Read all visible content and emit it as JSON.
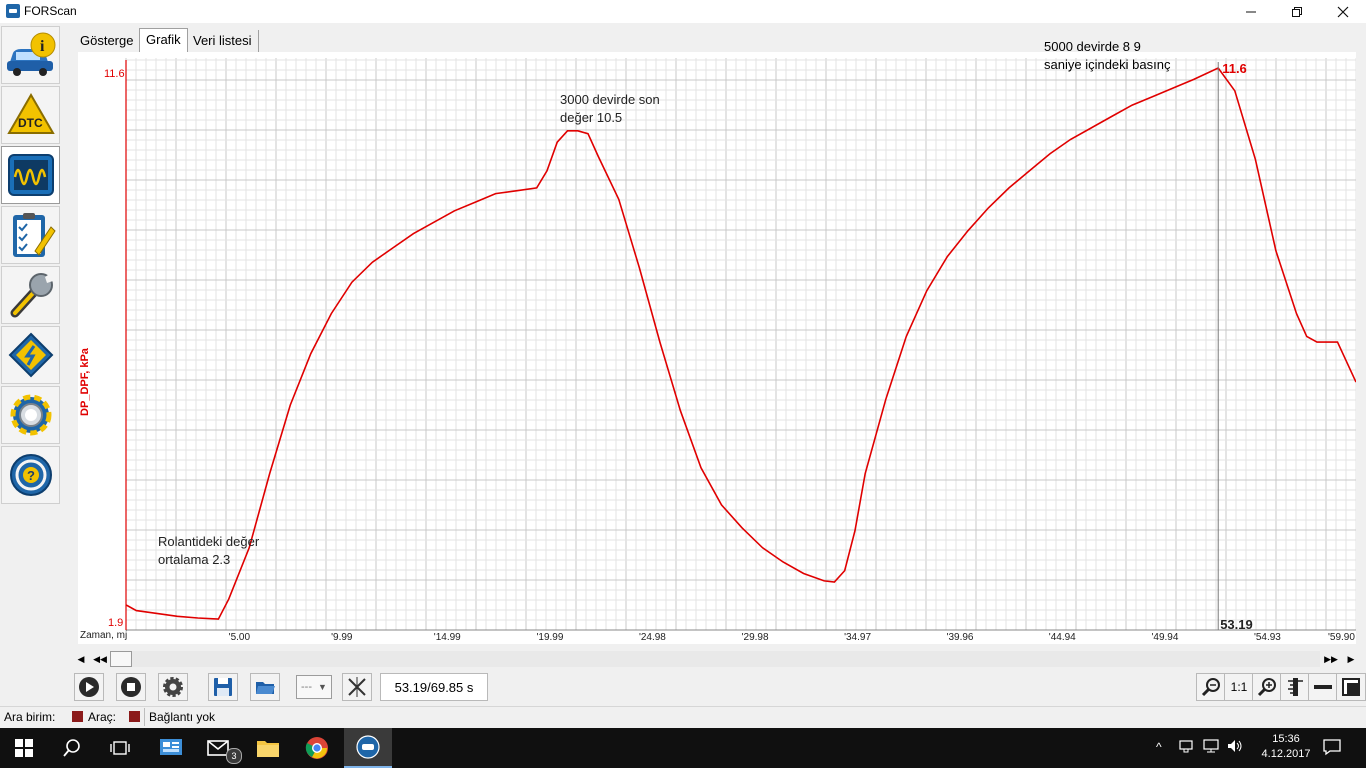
{
  "window": {
    "title": "FORScan"
  },
  "tabs": [
    {
      "label": "Gösterge"
    },
    {
      "label": "Grafik"
    },
    {
      "label": "Veri listesi"
    }
  ],
  "sidebar": {
    "items": [
      {
        "name": "vehicle-info",
        "icon": "car-info-icon"
      },
      {
        "name": "dtc",
        "icon": "dtc-warning-icon"
      },
      {
        "name": "oscilloscope",
        "icon": "oscilloscope-icon"
      },
      {
        "name": "tests",
        "icon": "checklist-icon"
      },
      {
        "name": "service",
        "icon": "wrench-icon"
      },
      {
        "name": "configuration",
        "icon": "chip-icon"
      },
      {
        "name": "settings",
        "icon": "gear-icon"
      },
      {
        "name": "help",
        "icon": "help-steering-icon"
      }
    ]
  },
  "chart_data": {
    "type": "line",
    "ylabel": "DP_DPF, kPa",
    "xlabel": "Zaman, mj",
    "ylim": [
      1.9,
      11.6
    ],
    "xlim": [
      0,
      59.9
    ],
    "y_min_label": "1.9",
    "y_max_label": "11.6",
    "x_tick_labels": [
      "5.00",
      "9.99",
      "14.99",
      "19.99",
      "24.98",
      "29.98",
      "34.97",
      "39.96",
      "44.94",
      "49.94",
      "54.93",
      "59.90"
    ],
    "x_ticks": [
      5.0,
      9.99,
      14.99,
      19.99,
      24.98,
      29.98,
      34.97,
      39.96,
      44.94,
      49.94,
      54.93,
      59.9
    ],
    "series_color": "#e00000",
    "grid": true,
    "series": [
      {
        "x": [
          0,
          0.5,
          1.5,
          2.5,
          3.5,
          4.5,
          5,
          6,
          7,
          8,
          9,
          10,
          11,
          12,
          13,
          14,
          15,
          16,
          17,
          18,
          19,
          20,
          20.5,
          21,
          21.5,
          22,
          22.5,
          23,
          24,
          25,
          26,
          27,
          28,
          29,
          30,
          31,
          32,
          33,
          34,
          34.5,
          35,
          35.5,
          36,
          37,
          38,
          39,
          40,
          41,
          42,
          43,
          44,
          45,
          46,
          47,
          48,
          49,
          50,
          51,
          52,
          53.19,
          54,
          55,
          56,
          57,
          57.5,
          58,
          58.5,
          59,
          59.9
        ],
        "y": [
          2.2,
          2.1,
          2.05,
          2.0,
          1.97,
          1.95,
          2.3,
          3.2,
          4.5,
          5.7,
          6.6,
          7.3,
          7.85,
          8.2,
          8.45,
          8.7,
          8.9,
          9.1,
          9.25,
          9.4,
          9.45,
          9.5,
          9.8,
          10.3,
          10.5,
          10.5,
          10.45,
          10.05,
          9.3,
          8.1,
          6.8,
          5.6,
          4.6,
          3.95,
          3.55,
          3.2,
          2.95,
          2.75,
          2.62,
          2.6,
          2.8,
          3.5,
          4.5,
          5.8,
          6.9,
          7.7,
          8.3,
          8.75,
          9.15,
          9.5,
          9.8,
          10.1,
          10.35,
          10.55,
          10.75,
          10.95,
          11.1,
          11.25,
          11.4,
          11.6,
          11.2,
          10.0,
          8.4,
          7.3,
          6.9,
          6.8,
          6.8,
          6.8,
          6.1
        ]
      }
    ],
    "cursor": {
      "x": 53.19,
      "x_label": "53.19",
      "y_label": "11.6"
    },
    "annotations": [
      {
        "text": "Rolantideki değer ortalama 2.3",
        "lines": [
          "Rolantideki değer",
          "ortalama 2.3"
        ]
      },
      {
        "text": "3000 devirde son değer 10.5",
        "lines": [
          "3000 devirde son",
          "değer 10.5"
        ]
      },
      {
        "text": "5000 devirde 8 9 saniye içindeki basınç",
        "lines": [
          "5000 devirde 8 9",
          "saniye içindeki basınç"
        ]
      }
    ]
  },
  "toolbar": {
    "time_display": "53.19/69.85 s",
    "select_value": "---",
    "zoom_ratio": "1:1"
  },
  "statusbar": {
    "ara_birim_label": "Ara birim:",
    "arac_label": "Araç:",
    "connection_status": "Bağlantı yok",
    "indicator_color": "#8b1a1a"
  },
  "taskbar": {
    "mail_badge": "3",
    "time": "15:36",
    "date": "4.12.2017"
  }
}
